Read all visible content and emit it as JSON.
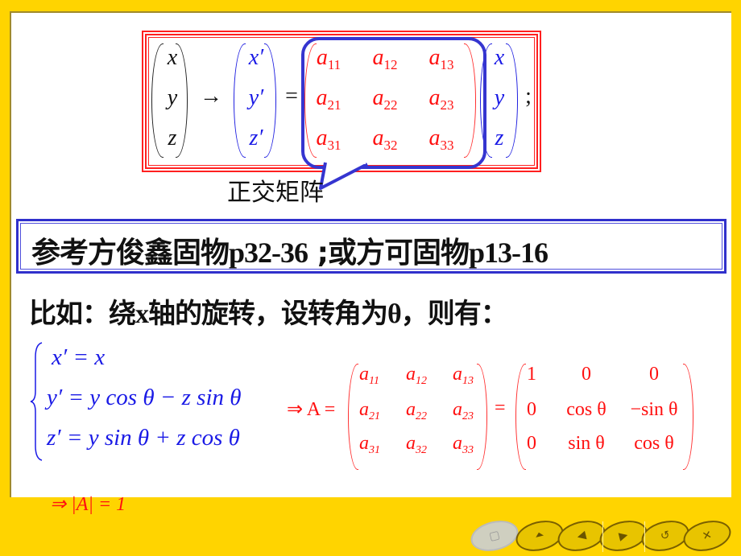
{
  "slide": {
    "top_equation": {
      "left_vector": [
        "x",
        "y",
        "z"
      ],
      "arrow": "→",
      "result_vector": [
        "x′",
        "y′",
        "z′"
      ],
      "equals": "=",
      "matrix": [
        [
          "a",
          "11"
        ],
        [
          "a",
          "12"
        ],
        [
          "a",
          "13"
        ],
        [
          "a",
          "21"
        ],
        [
          "a",
          "22"
        ],
        [
          "a",
          "23"
        ],
        [
          "a",
          "31"
        ],
        [
          "a",
          "32"
        ],
        [
          "a",
          "33"
        ]
      ],
      "right_vector": [
        "x",
        "y",
        "z"
      ],
      "terminator": ";"
    },
    "callout_label": "正交矩阵",
    "reference": {
      "part1": "参考方俊鑫固物",
      "pages1": "p32-36",
      "sep": " ;或方可固物",
      "pages2": "p13-16"
    },
    "example": {
      "p1": "比如：绕",
      "x": "x",
      "p2": "轴的旋转，设转角为",
      "theta": "θ",
      "p3": "，则有："
    },
    "system": [
      "x′ = x",
      "y′ = y cos θ − z sin θ",
      "z′ = y sin θ + z cos θ"
    ],
    "matrix_eq": {
      "prefix": "⇒ A =",
      "equals": "=",
      "symbolic": [
        [
          "a",
          "11"
        ],
        [
          "a",
          "12"
        ],
        [
          "a",
          "13"
        ],
        [
          "a",
          "21"
        ],
        [
          "a",
          "22"
        ],
        [
          "a",
          "23"
        ],
        [
          "a",
          "31"
        ],
        [
          "a",
          "32"
        ],
        [
          "a",
          "33"
        ]
      ],
      "numeric": [
        "1",
        "0",
        "0",
        "0",
        "cos θ",
        "−sin θ",
        "0",
        "sin θ",
        "cos θ"
      ]
    },
    "determinant": "⇒ |A| = 1"
  },
  "nav": {
    "buttons": [
      {
        "name": "home",
        "glyph": "▢"
      },
      {
        "name": "first",
        "glyph": "⏶"
      },
      {
        "name": "previous",
        "glyph": "◀"
      },
      {
        "name": "next",
        "glyph": "▶"
      },
      {
        "name": "return",
        "glyph": "↺"
      },
      {
        "name": "close",
        "glyph": "✕"
      }
    ]
  },
  "colors": {
    "frame": "#FFD400",
    "equation_red": "#ff1010",
    "equation_blue": "#1a1ae6",
    "callout_blue": "#3535d0"
  }
}
